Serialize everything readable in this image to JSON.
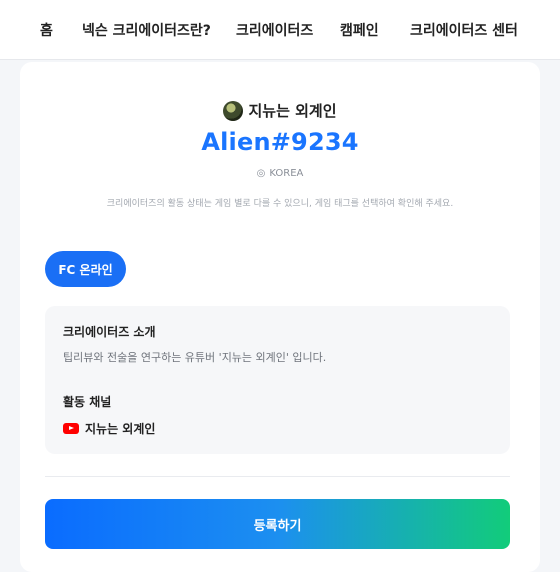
{
  "nav": {
    "items": [
      {
        "label": "홈"
      },
      {
        "label": "넥슨 크리에이터즈란?"
      },
      {
        "label": "크리에이터즈"
      },
      {
        "label": "캠페인"
      },
      {
        "label": "크리에이터즈 센터"
      }
    ]
  },
  "profile": {
    "display_name": "지뉴는 외계인",
    "game_tag": "Alien#9234",
    "country": "KOREA",
    "pin_icon": "location-pin-icon",
    "notice": "크리에이터즈의 활동 상태는 게임 별로 다를 수 있으니, 게임 태그를 선택하여 확인해 주세요."
  },
  "games": {
    "selected": "FC 온라인"
  },
  "info": {
    "intro_heading": "크리에이터즈 소개",
    "intro_text": "팁리뷰와 전술을 연구하는 유튜버 '지뉴는 외계인' 입니다.",
    "channel_heading": "활동 채널",
    "channel_name": "지뉴는 외계인",
    "channel_icon": "youtube-icon"
  },
  "actions": {
    "register_label": "등록하기"
  },
  "colors": {
    "accent": "#1a75ff",
    "chip": "#1a6ff5",
    "gradient_start": "#0a6cff",
    "gradient_end": "#12cc7a",
    "youtube": "#ff0000"
  }
}
